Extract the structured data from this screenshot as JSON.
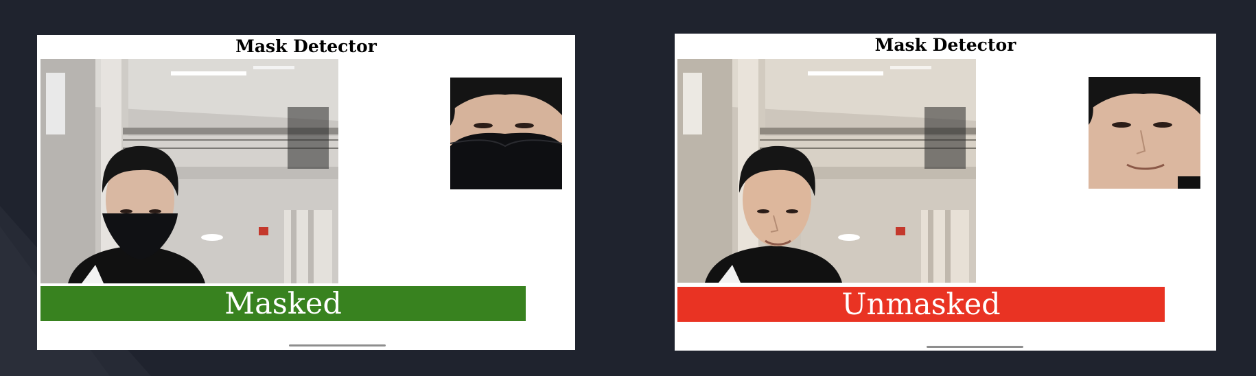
{
  "background_color": "#1f232e",
  "panels": [
    {
      "title": "Mask Detector",
      "status_label": "Masked",
      "status_color": "#38821f",
      "feed_icon": "camera-feed-masked-person",
      "face_crop_icon": "face-crop-masked"
    },
    {
      "title": "Mask Detector",
      "status_label": "Unmasked",
      "status_color": "#e93323",
      "feed_icon": "camera-feed-unmasked-person",
      "face_crop_icon": "face-crop-unmasked"
    }
  ]
}
